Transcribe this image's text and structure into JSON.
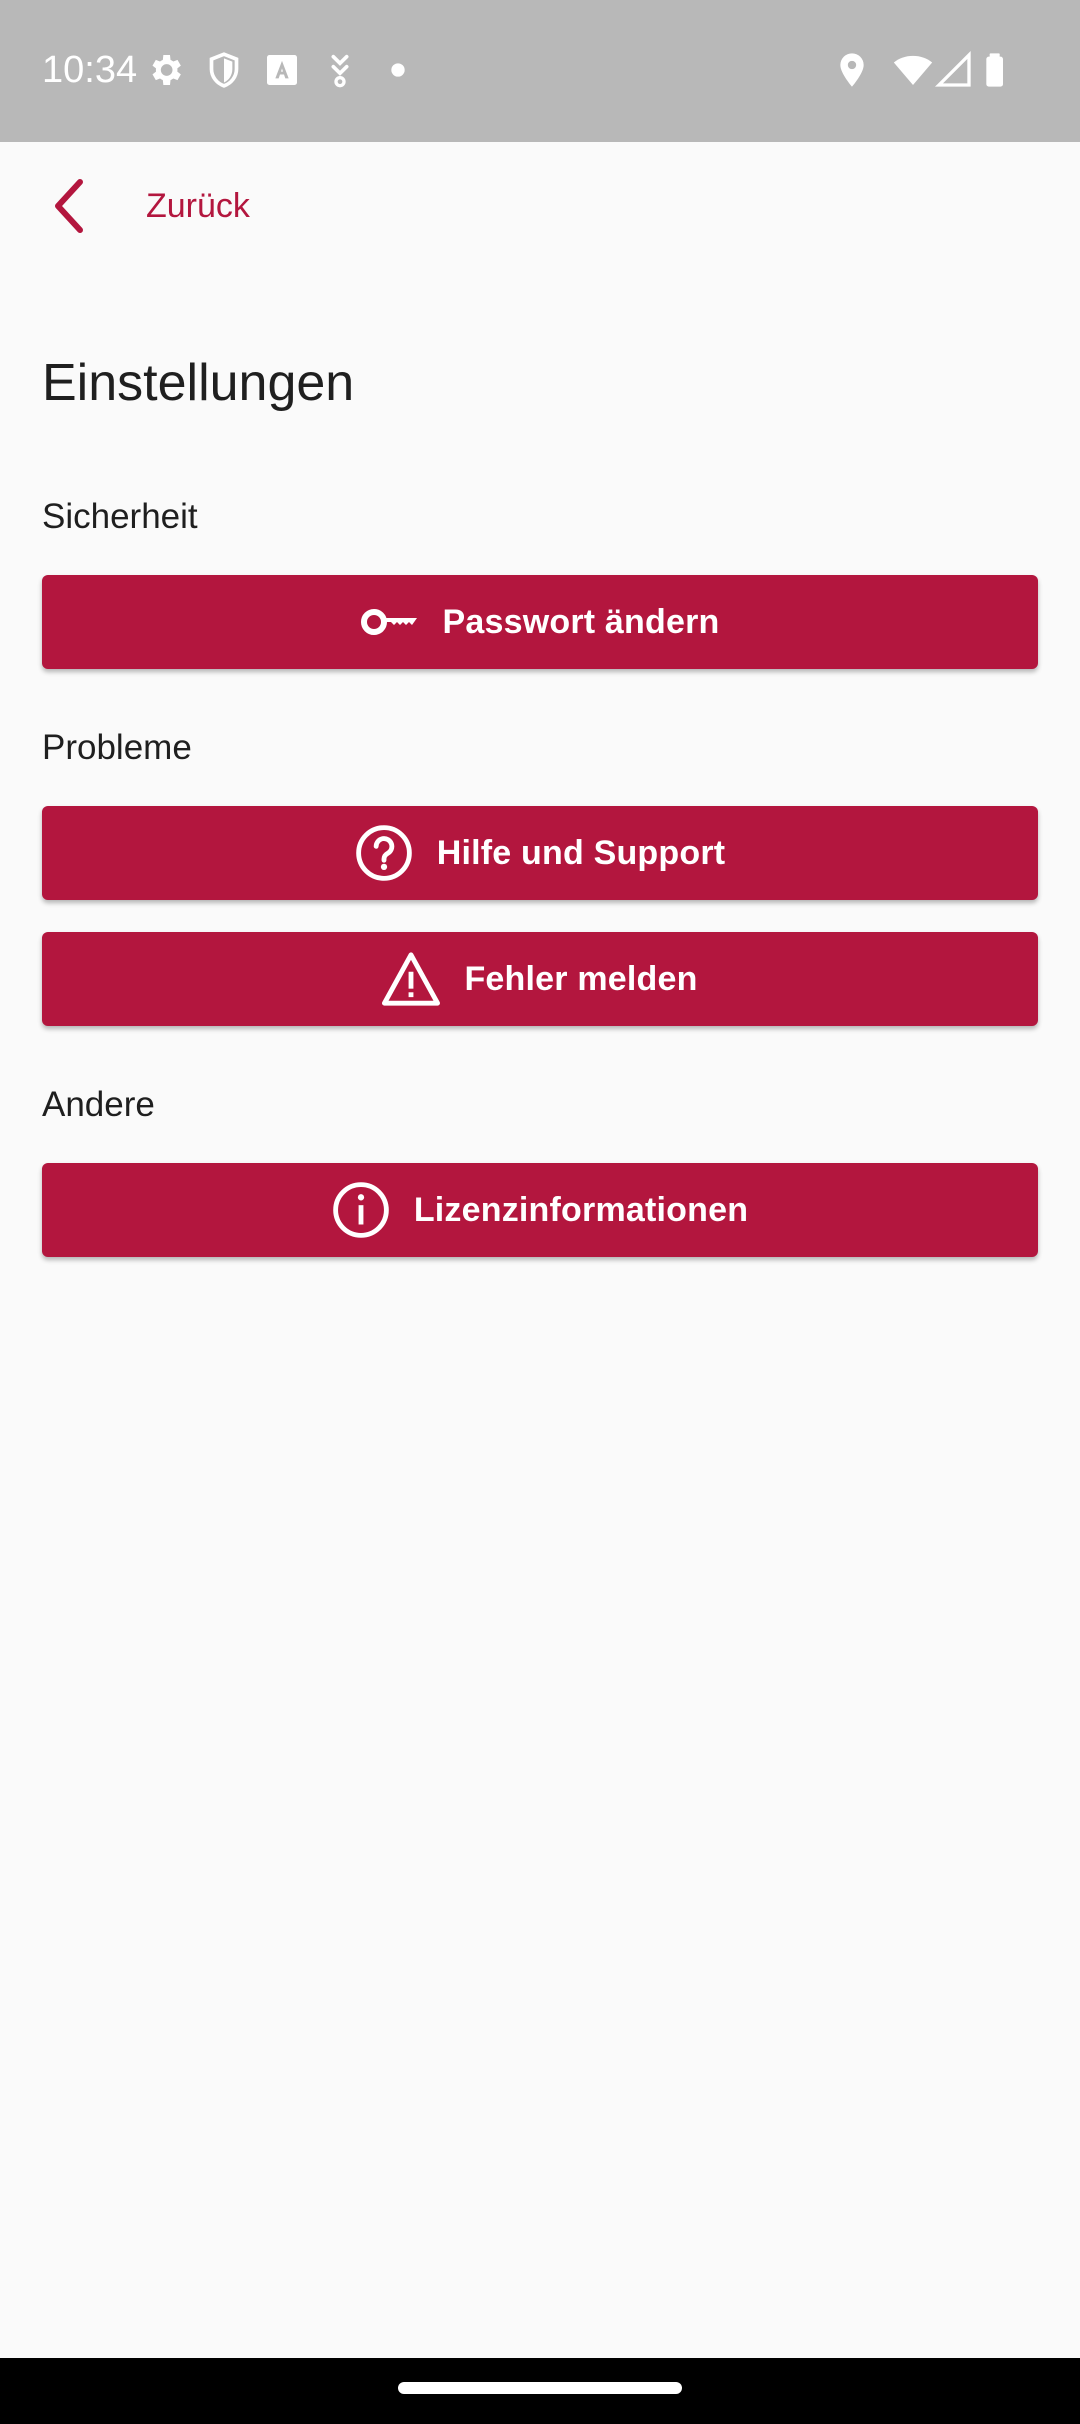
{
  "status_bar": {
    "time": "10:34",
    "left_icons": [
      "gear-icon",
      "shield-icon",
      "font-icon",
      "download-icon",
      "dot-icon"
    ],
    "right_icons": [
      "location-icon",
      "wifi-icon",
      "signal-icon",
      "battery-icon"
    ]
  },
  "nav": {
    "back_label": "Zurück"
  },
  "page": {
    "title": "Einstellungen"
  },
  "sections": {
    "security": {
      "label": "Sicherheit",
      "change_password": {
        "label": "Passwort ändern",
        "icon": "key-icon"
      }
    },
    "problems": {
      "label": "Probleme",
      "help_support": {
        "label": "Hilfe und Support",
        "icon": "help-circle-icon"
      },
      "report_error": {
        "label": "Fehler melden",
        "icon": "warning-icon"
      }
    },
    "other": {
      "label": "Andere",
      "license_info": {
        "label": "Lizenzinformationen",
        "icon": "info-circle-icon"
      }
    }
  },
  "colors": {
    "accent": "#B3163E",
    "background": "#FAFAFA",
    "status_bar": "#B8B8B8",
    "text": "#1F1F1F"
  }
}
